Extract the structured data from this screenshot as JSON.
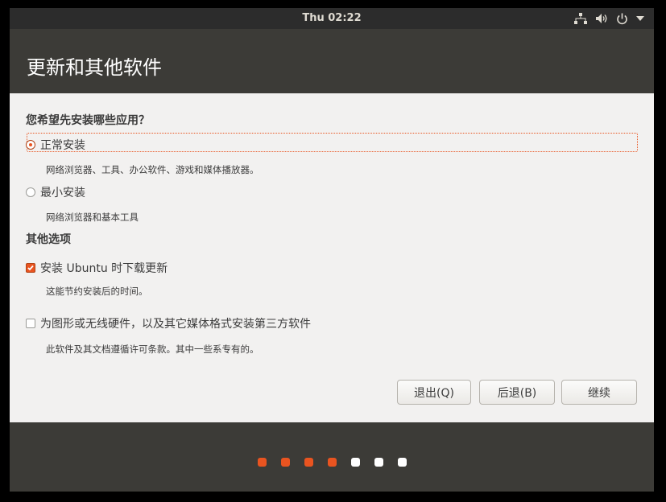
{
  "topbar": {
    "clock": "Thu 02:22"
  },
  "tray_icons": [
    "network-icon",
    "volume-icon",
    "power-icon",
    "chevron-down-icon"
  ],
  "window": {
    "title": "更新和其他软件"
  },
  "install_section": {
    "heading": "您希望先安装哪些应用？",
    "normal": {
      "label": "正常安装",
      "desc": "网络浏览器、工具、办公软件、游戏和媒体播放器。",
      "selected": true
    },
    "minimal": {
      "label": "最小安装",
      "desc": "网络浏览器和基本工具",
      "selected": false
    }
  },
  "other_section": {
    "heading": "其他选项",
    "updates": {
      "label": "安装 Ubuntu 时下载更新",
      "desc": "这能节约安装后的时间。",
      "checked": true
    },
    "third_party": {
      "label": "为图形或无线硬件，以及其它媒体格式安装第三方软件",
      "desc": "此软件及其文档遵循许可条款。其中一些系专有的。",
      "checked": false
    }
  },
  "buttons": {
    "quit": "退出(Q)",
    "back": "后退(B)",
    "continue": "继续"
  },
  "progress": {
    "steps_total": 7,
    "steps_done": 4
  },
  "colors": {
    "accent": "#e95420",
    "done_dot": "#e95420",
    "todo_dot": "#ffffff",
    "panel": "#3c3b37"
  }
}
